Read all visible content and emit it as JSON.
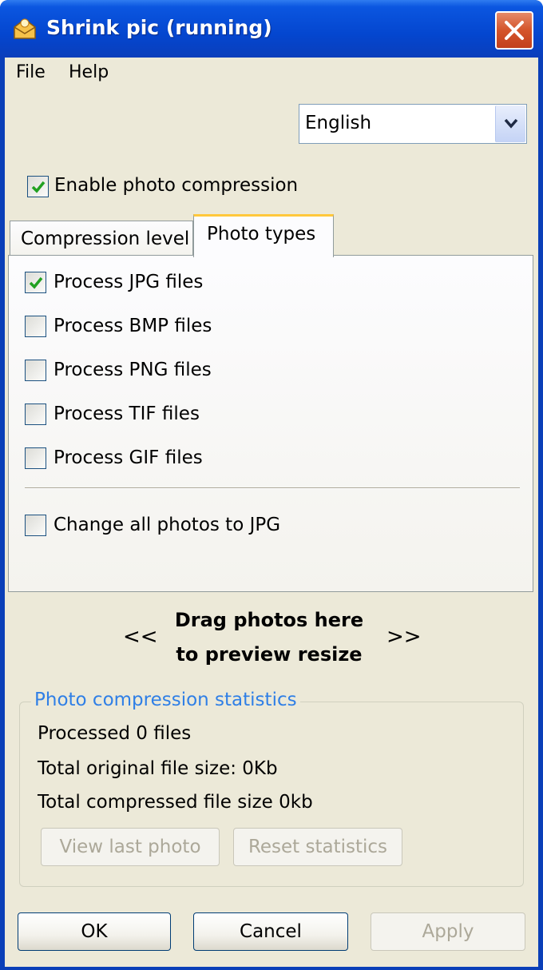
{
  "window": {
    "title": "Shrink pic (running)"
  },
  "menu": {
    "file": "File",
    "help": "Help"
  },
  "language": {
    "selected": "English"
  },
  "enable_compression": {
    "label": "Enable photo compression",
    "checked": true
  },
  "tabs": [
    {
      "label": "Compression level",
      "active": false
    },
    {
      "label": "Photo types",
      "active": true
    }
  ],
  "photo_types": [
    {
      "label": "Process JPG files",
      "checked": true
    },
    {
      "label": "Process BMP files",
      "checked": false
    },
    {
      "label": "Process PNG files",
      "checked": false
    },
    {
      "label": "Process TIF files",
      "checked": false
    },
    {
      "label": "Process GIF files",
      "checked": false
    }
  ],
  "convert_jpg": {
    "label": "Change all photos to JPG",
    "checked": false
  },
  "drag": {
    "line1": "Drag photos here",
    "line2": "to preview resize",
    "left": "<<",
    "right": ">>"
  },
  "stats": {
    "legend": "Photo compression statistics",
    "processed": "Processed 0 files",
    "original_size": "Total original file size: 0Kb",
    "compressed_size": "Total compressed file size 0kb",
    "view_last": "View last photo",
    "reset": "Reset statistics"
  },
  "buttons": {
    "ok": "OK",
    "cancel": "Cancel",
    "apply": "Apply"
  },
  "colors": {
    "title_bar": "#0446cf",
    "face": "#ece9d8",
    "legend": "#2f7fe6",
    "tab_highlight": "#ffc83c"
  }
}
